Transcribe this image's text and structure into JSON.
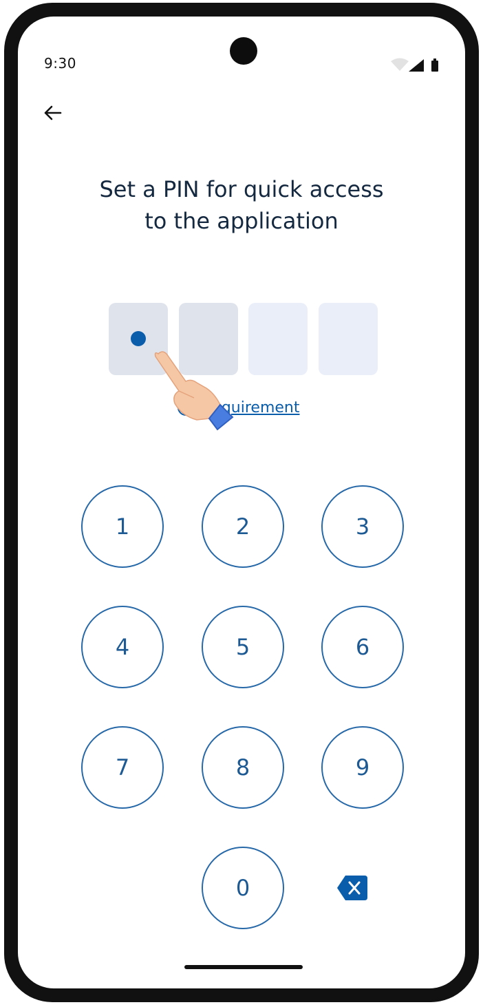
{
  "status_bar": {
    "time": "9:30"
  },
  "header": {
    "back_icon": "arrow-left-icon"
  },
  "title": {
    "line1": "Set a PIN for quick access",
    "line2": "to the application"
  },
  "pin": {
    "length": 4,
    "entered": 1
  },
  "requirement": {
    "icon": "info-icon",
    "info_glyph": "i",
    "label": "Requirement"
  },
  "keypad": {
    "keys": [
      "1",
      "2",
      "3",
      "4",
      "5",
      "6",
      "7",
      "8",
      "9",
      "0"
    ],
    "backspace_icon": "backspace-icon"
  },
  "colors": {
    "accent": "#0a5dab",
    "title": "#14283f",
    "pin_box_filled": "#dfe3ec",
    "pin_box_empty": "#e9eef8"
  }
}
